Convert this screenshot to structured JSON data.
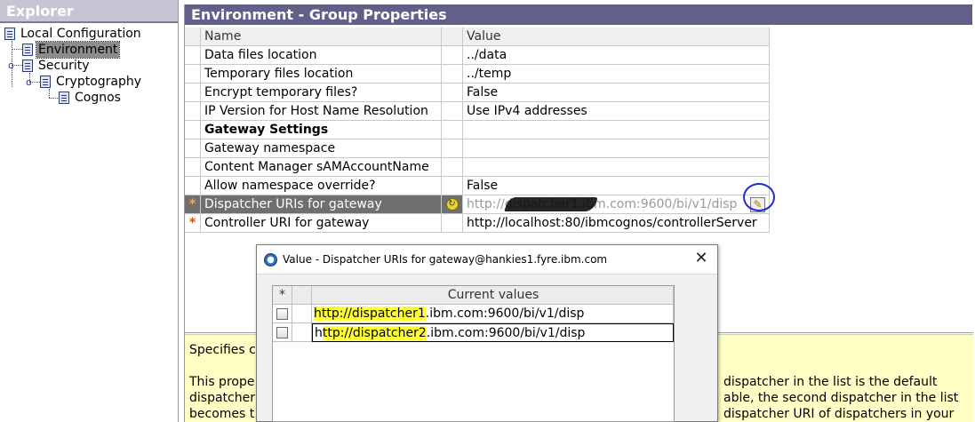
{
  "explorer": {
    "title": "Explorer",
    "tree": [
      {
        "label": "Local Configuration"
      },
      {
        "label": "Environment",
        "selected": true
      },
      {
        "label": "Security"
      },
      {
        "label": "Cryptography"
      },
      {
        "label": "Cognos"
      }
    ]
  },
  "properties": {
    "title": "Environment - Group Properties",
    "columns": {
      "name": "Name",
      "value": "Value"
    },
    "rows": [
      {
        "name": "Data files location",
        "value": "../data"
      },
      {
        "name": "Temporary files location",
        "value": "../temp"
      },
      {
        "name": "Encrypt temporary files?",
        "value": "False"
      },
      {
        "name": "IP Version for Host Name Resolution",
        "value": "Use IPv4 addresses"
      },
      {
        "name": "Gateway Settings",
        "value": ""
      },
      {
        "name": "Gateway namespace",
        "value": ""
      },
      {
        "name": "Content Manager sAMAccountName",
        "value": ""
      },
      {
        "name": "Allow namespace override?",
        "value": "False"
      },
      {
        "name": "Dispatcher URIs for gateway",
        "value": "http://dispatcher1.ibm.com:9600/bi/v1/disp",
        "required_mark": "*"
      },
      {
        "name": "Controller URI for gateway",
        "value": "http://localhost:80/ibmcognos/controllerServer",
        "required_mark": "*"
      }
    ],
    "description": {
      "line1": "Specifies c",
      "line2_left": "This prope",
      "line2_right": "dispatcher in the list is the default",
      "line3_left": "dispatcher",
      "line3_right": "able, the second dispatcher in the list",
      "line4_left": "becomes t",
      "line4_right": "dispatcher URI of dispatchers in your"
    }
  },
  "dialog": {
    "title": "Value - Dispatcher URIs for gateway@hankies1.fyre.ibm.com",
    "close_glyph": "✕",
    "table": {
      "star_header": "*",
      "value_header": "Current values",
      "values": [
        {
          "prefix": "",
          "highlight": "http://dispatcher1",
          "rest": ".ibm.com:9600/bi/v1/disp"
        },
        {
          "prefix": "h",
          "highlight": "ttp://dispatcher2",
          "rest": ".ibm.com:9600/bi/v1/disp"
        }
      ]
    }
  },
  "colors": {
    "explorer_title_bg": "#c5c5d3",
    "properties_title_bg": "#60608a",
    "description_bg": "#ffffc6",
    "highlight": "#ffff33",
    "annotation_circle": "#1d2bd8"
  },
  "icons": {
    "tree_node": "document-list-icon",
    "refresh": "refresh-icon",
    "edit": "pencil-icon",
    "app": "cognos-app-icon"
  }
}
